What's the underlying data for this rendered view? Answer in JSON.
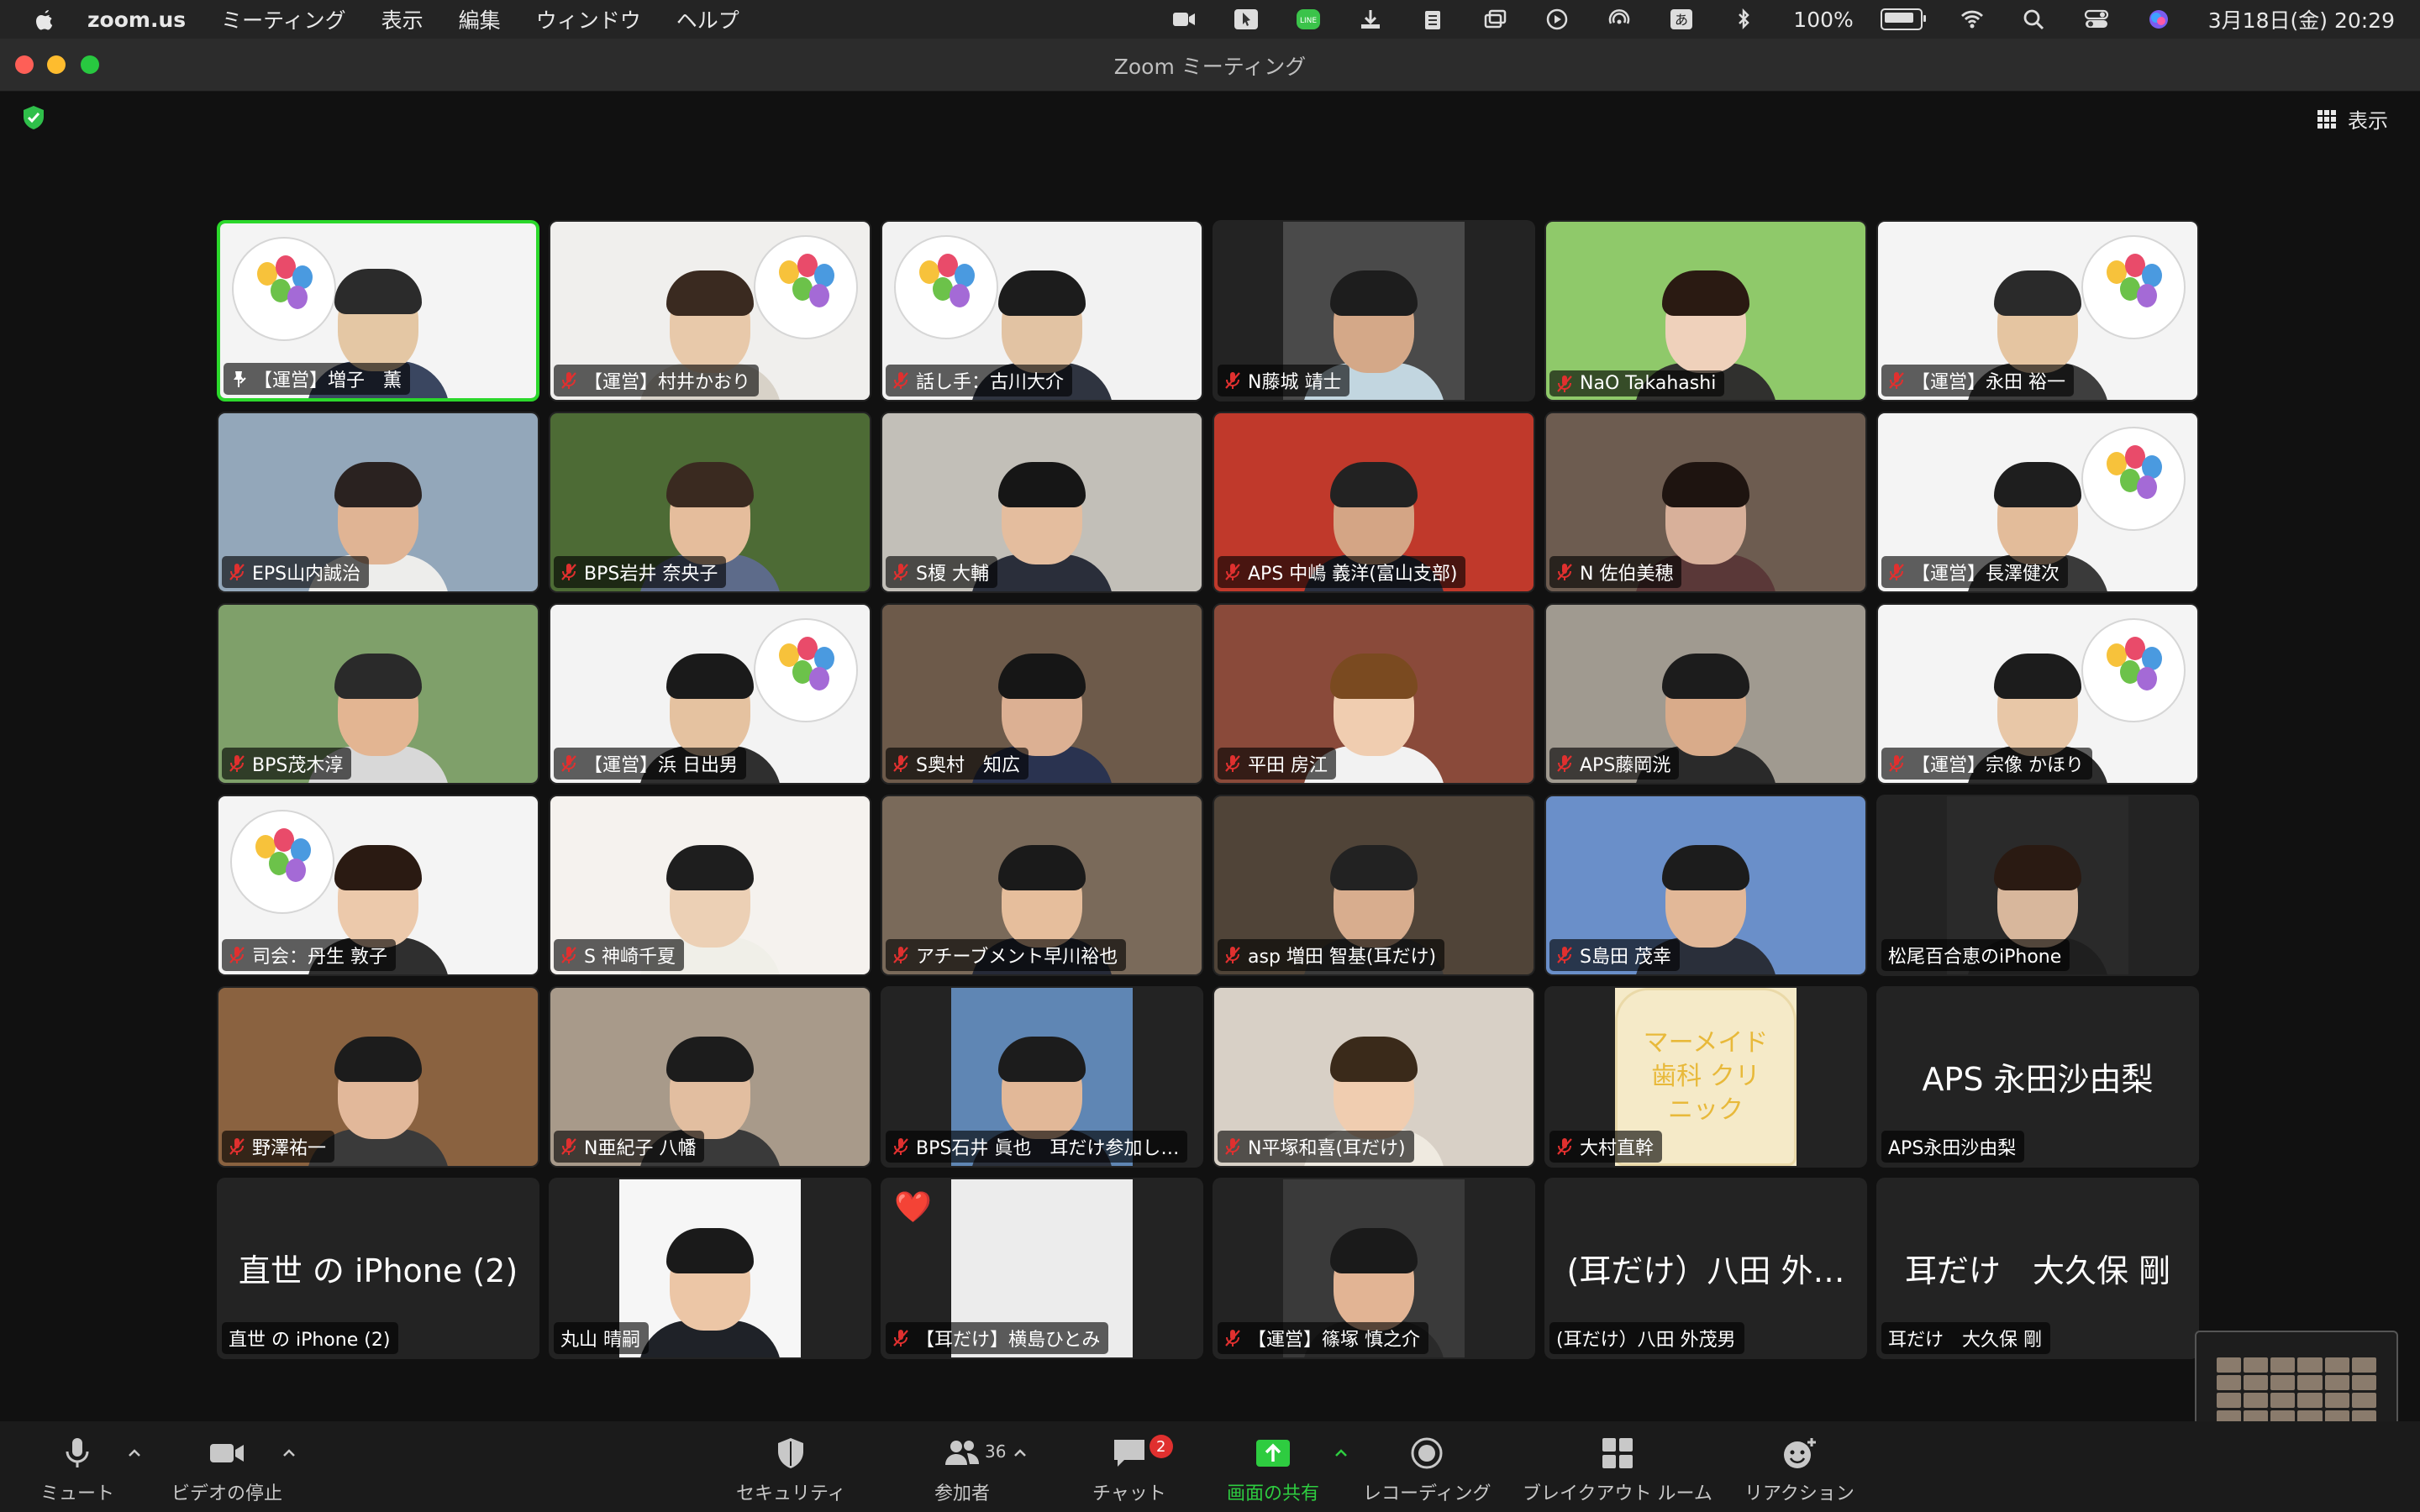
{
  "menubar": {
    "app_name": "zoom.us",
    "items": [
      "ミーティング",
      "表示",
      "編集",
      "ウィンドウ",
      "ヘルプ"
    ],
    "battery_percent": "100%",
    "datetime": "3月18日(金)  20:29",
    "ime_label": "あ"
  },
  "window": {
    "title": "Zoom ミーティング"
  },
  "view_button": {
    "label": "表示"
  },
  "tiles": [
    {
      "name": "【運営】増子　薫",
      "active": true,
      "pinned": true
    },
    {
      "name": "【運営】村井かおり"
    },
    {
      "name": "話し手：古川大介"
    },
    {
      "name": "N藤城 靖士"
    },
    {
      "name": "NaO Takahashi"
    },
    {
      "name": "【運営】永田 裕一"
    },
    {
      "name": "EPS山内誠治"
    },
    {
      "name": "BPS岩井 奈央子"
    },
    {
      "name": "S榎 大輔"
    },
    {
      "name": "APS 中嶋 義洋(富山支部)"
    },
    {
      "name": "N 佐伯美穂"
    },
    {
      "name": "【運営】長澤健次"
    },
    {
      "name": "BPS茂木淳"
    },
    {
      "name": "【運営】浜 日出男"
    },
    {
      "name": "S奥村　知広"
    },
    {
      "name": "平田 房江"
    },
    {
      "name": "APS藤岡洸"
    },
    {
      "name": "【運営】宗像 かほり"
    },
    {
      "name": "司会：丹生 敦子"
    },
    {
      "name": "S 神崎千夏"
    },
    {
      "name": "アチーブメント早川裕也"
    },
    {
      "name": "asp 増田 智基(耳だけ)"
    },
    {
      "name": "S島田 茂幸"
    },
    {
      "name": "松尾百合恵のiPhone"
    },
    {
      "name": "野澤祐一"
    },
    {
      "name": "N亜紀子 八幡"
    },
    {
      "name": "BPS石井 眞也　耳だけ参加し…"
    },
    {
      "name": "N平塚和喜(耳だけ)"
    },
    {
      "name": "大村直幹",
      "poster_text": "マーメイド歯科 クリニック"
    },
    {
      "name": "APS永田沙由梨",
      "display": "APS 永田沙由梨"
    },
    {
      "name": "直世 の iPhone (2)",
      "display": "直世 の iPhone (2)"
    },
    {
      "name": "丸山 晴嗣"
    },
    {
      "name": "【耳だけ】横島ひとみ",
      "reaction": "❤️"
    },
    {
      "name": "【運営】篠塚 慎之介"
    },
    {
      "name": "(耳だけ）八田 外茂男",
      "display": "(耳だけ）八田 外…"
    },
    {
      "name": "耳だけ　大久保 剛",
      "display": "耳だけ　大久保 剛"
    }
  ],
  "toolbar": {
    "mute": "ミュート",
    "video": "ビデオの停止",
    "security": "セキュリティ",
    "participants": "参加者",
    "participants_count": "36",
    "chat": "チャット",
    "chat_badge": "2",
    "share": "画面の共有",
    "record": "レコーディング",
    "breakout": "ブレイクアウト ルーム",
    "reactions": "リアクション"
  },
  "colors": {
    "active_speaker": "#2bd82b",
    "muted_mic": "#e0302f",
    "share_green": "#2ecc40",
    "background": "#111111"
  }
}
